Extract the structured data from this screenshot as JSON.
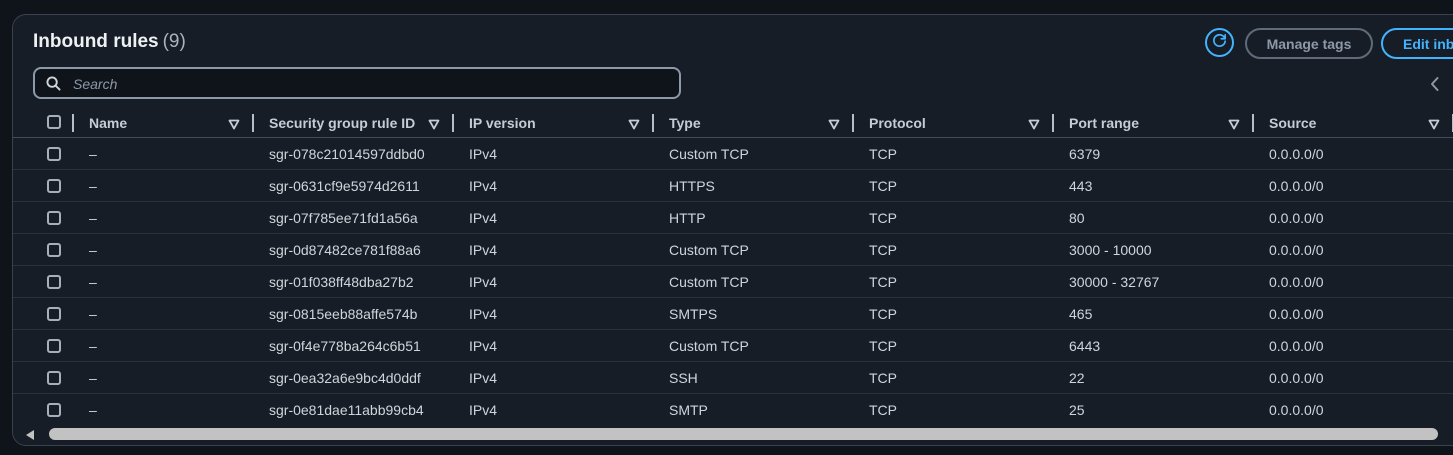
{
  "header": {
    "title": "Inbound rules",
    "count": "(9)",
    "manage_tags_label": "Manage tags",
    "edit_label": "Edit inb"
  },
  "search": {
    "placeholder": "Search",
    "value": ""
  },
  "table": {
    "columns": [
      "Name",
      "Security group rule ID",
      "IP version",
      "Type",
      "Protocol",
      "Port range",
      "Source"
    ],
    "rows": [
      [
        "–",
        "sgr-078c21014597ddbd0",
        "IPv4",
        "Custom TCP",
        "TCP",
        "6379",
        "0.0.0.0/0"
      ],
      [
        "–",
        "sgr-0631cf9e5974d2611",
        "IPv4",
        "HTTPS",
        "TCP",
        "443",
        "0.0.0.0/0"
      ],
      [
        "–",
        "sgr-07f785ee71fd1a56a",
        "IPv4",
        "HTTP",
        "TCP",
        "80",
        "0.0.0.0/0"
      ],
      [
        "–",
        "sgr-0d87482ce781f88a6",
        "IPv4",
        "Custom TCP",
        "TCP",
        "3000 - 10000",
        "0.0.0.0/0"
      ],
      [
        "–",
        "sgr-01f038ff48dba27b2",
        "IPv4",
        "Custom TCP",
        "TCP",
        "30000 - 32767",
        "0.0.0.0/0"
      ],
      [
        "–",
        "sgr-0815eeb88affe574b",
        "IPv4",
        "SMTPS",
        "TCP",
        "465",
        "0.0.0.0/0"
      ],
      [
        "–",
        "sgr-0f4e778ba264c6b51",
        "IPv4",
        "Custom TCP",
        "TCP",
        "6443",
        "0.0.0.0/0"
      ],
      [
        "–",
        "sgr-0ea32a6e9bc4d0ddf",
        "IPv4",
        "SSH",
        "TCP",
        "22",
        "0.0.0.0/0"
      ],
      [
        "–",
        "sgr-0e81dae11abb99cb4",
        "IPv4",
        "SMTP",
        "TCP",
        "25",
        "0.0.0.0/0"
      ]
    ]
  },
  "icons": {
    "refresh": "refresh-icon",
    "search": "search-icon",
    "sort": "sort-caret-icon",
    "prev_page": "chevron-left-icon",
    "scroll_left": "scroll-left-arrow-icon"
  },
  "colors": {
    "accent": "#42b4ff",
    "panel_bg": "#161d26",
    "page_bg": "#0f141a",
    "text": "#d1d5db"
  }
}
